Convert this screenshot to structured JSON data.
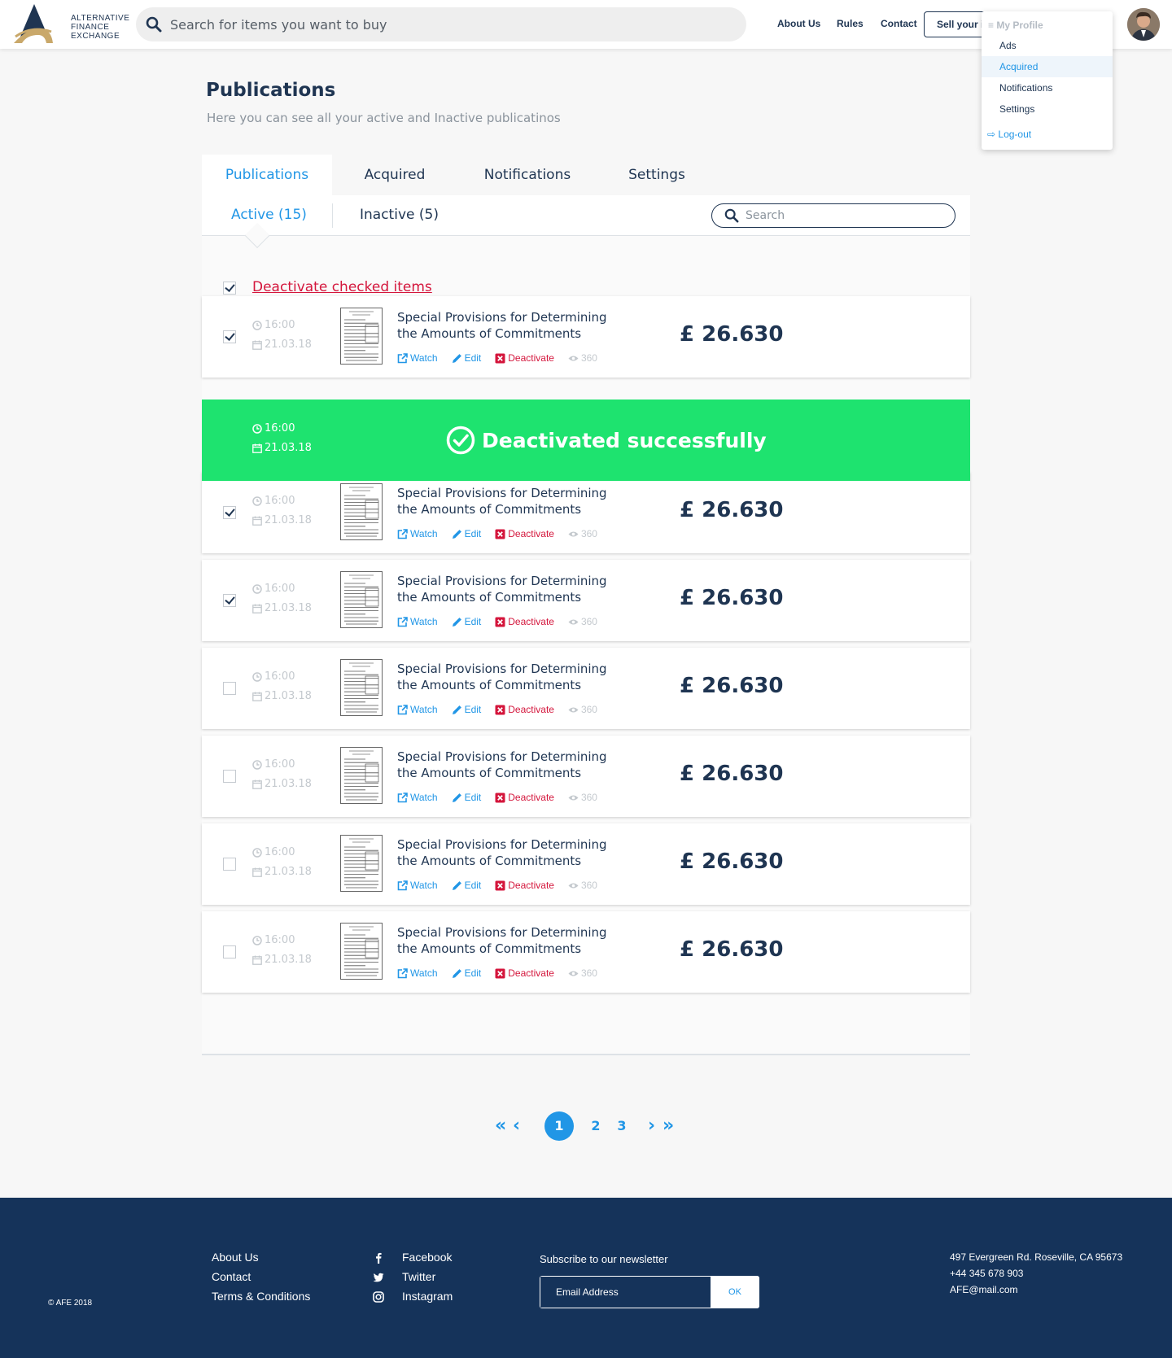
{
  "brand": {
    "line1": "ALTERNATIVE",
    "line2": "FINANCE",
    "line3": "EXCHANGE"
  },
  "header": {
    "search_placeholder": "Search for items you want to buy",
    "nav": [
      "About Us",
      "Rules",
      "Contact"
    ],
    "sell_label": "Sell your item"
  },
  "profile_menu": {
    "heading": "My Profile",
    "items": [
      "Ads",
      "Acquired",
      "Notifications",
      "Settings"
    ],
    "active_item": "Acquired",
    "logout": "Log-out"
  },
  "page": {
    "title": "Publications",
    "subtitle": "Here you can see all your active and Inactive publicatinos"
  },
  "tabs": [
    "Publications",
    "Acquired",
    "Notifications",
    "Settings"
  ],
  "subtabs": {
    "active": "Active (15)",
    "inactive": "Inactive (5)",
    "search_placeholder": "Search"
  },
  "bulk": {
    "checked": true,
    "label": "Deactivate checked items"
  },
  "item_defaults": {
    "time": "16:00",
    "date": "21.03.18",
    "title_line1": "Special Provisions for Determining",
    "title_line2": "the Amounts of Commitments",
    "price": "£ 26.630",
    "watch": "Watch",
    "edit": "Edit",
    "deactivate": "Deactivate",
    "views": "360"
  },
  "items": [
    {
      "checked": true
    },
    {
      "checked": true
    },
    {
      "checked": true
    },
    {
      "checked": false
    },
    {
      "checked": false
    },
    {
      "checked": false
    },
    {
      "checked": false
    }
  ],
  "success": {
    "time": "16:00",
    "date": "21.03.18",
    "message": "Deactivated successfully"
  },
  "pagination": {
    "pages": [
      "1",
      "2",
      "3"
    ],
    "current": "1"
  },
  "footer": {
    "links": [
      "About Us",
      "Contact",
      "Terms & Conditions"
    ],
    "social": [
      "Facebook",
      "Twitter",
      "Instagram"
    ],
    "newsletter_title": "Subscribe to our newsletter",
    "email_placeholder": "Email Address",
    "ok_label": "OK",
    "address": "497 Evergreen Rd. Roseville, CA 95673",
    "phone": "+44 345 678 903",
    "email": "AFE@mail.com",
    "copyright": "© AFE 2018"
  },
  "colors": {
    "navy": "#1f3552",
    "accent": "#2196e6",
    "danger": "#d4163c",
    "success": "#1ee36f",
    "footer": "#15335a"
  }
}
